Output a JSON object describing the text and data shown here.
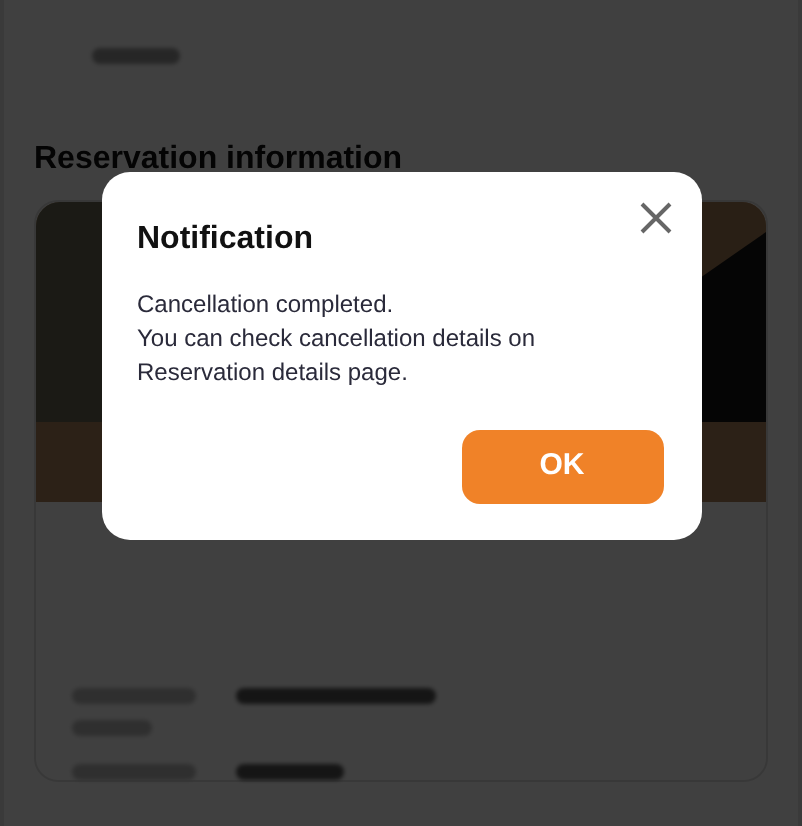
{
  "page": {
    "section_title": "Reservation information"
  },
  "dialog": {
    "title": "Notification",
    "lines": [
      "Cancellation completed.",
      "You can check cancellation details on Reservation details page."
    ],
    "button": "OK"
  }
}
